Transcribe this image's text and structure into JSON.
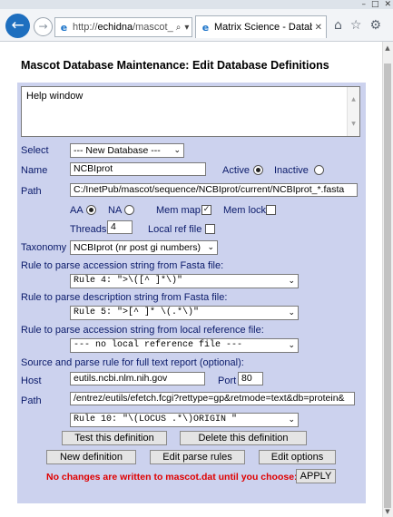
{
  "browser": {
    "url_host": "echidna",
    "url_scheme": "http://",
    "url_rest": "/mascot_",
    "tab_title": "Matrix Science - Datab..."
  },
  "page": {
    "title": "Mascot Database Maintenance: Edit Database Definitions",
    "help_text": "Help window"
  },
  "form": {
    "select_label": "Select",
    "select_value": "--- New Database ---",
    "name_label": "Name",
    "name_value": "NCBIprot",
    "active_label": "Active",
    "inactive_label": "Inactive",
    "path_label": "Path",
    "path_value": "C:/InetPub/mascot/sequence/NCBIprot/current/NCBIprot_*.fasta",
    "aa_label": "AA",
    "na_label": "NA",
    "memmap_label": "Mem map",
    "memlock_label": "Mem lock",
    "threads_label": "Threads",
    "threads_value": "4",
    "localref_label": "Local ref file",
    "taxonomy_label": "Taxonomy",
    "taxonomy_value": "NCBIprot (nr post gi numbers)",
    "rule_acc_label": "Rule to parse accession string from Fasta file:",
    "rule_acc_value": "Rule 4: \">\\([^ ]*\\)\"",
    "rule_desc_label": "Rule to parse description string from Fasta file:",
    "rule_desc_value": "Rule 5: \">[^ ]* \\(.*\\)\"",
    "rule_local_label": "Rule to parse accession string from local reference file:",
    "rule_local_value": "--- no local reference file ---",
    "source_label": "Source and parse rule for full text report (optional):",
    "host_label": "Host",
    "host_value": "eutils.ncbi.nlm.nih.gov",
    "port_label": "Port",
    "port_value": "80",
    "path2_label": "Path",
    "path2_value": "/entrez/eutils/efetch.fcgi?rettype=gp&retmode=text&db=protein&",
    "rule_report_value": "Rule 10: \"\\(LOCUS .*\\)ORIGIN \""
  },
  "buttons": {
    "test": "Test this definition",
    "delete": "Delete this definition",
    "new_def": "New definition",
    "edit_rules": "Edit parse rules",
    "edit_options": "Edit options",
    "apply": "APPLY"
  },
  "warning": "No changes are written to mascot.dat until you choose:",
  "state": {
    "active": true,
    "aa": true,
    "mem_map": true,
    "mem_lock": false,
    "local_ref": false
  }
}
